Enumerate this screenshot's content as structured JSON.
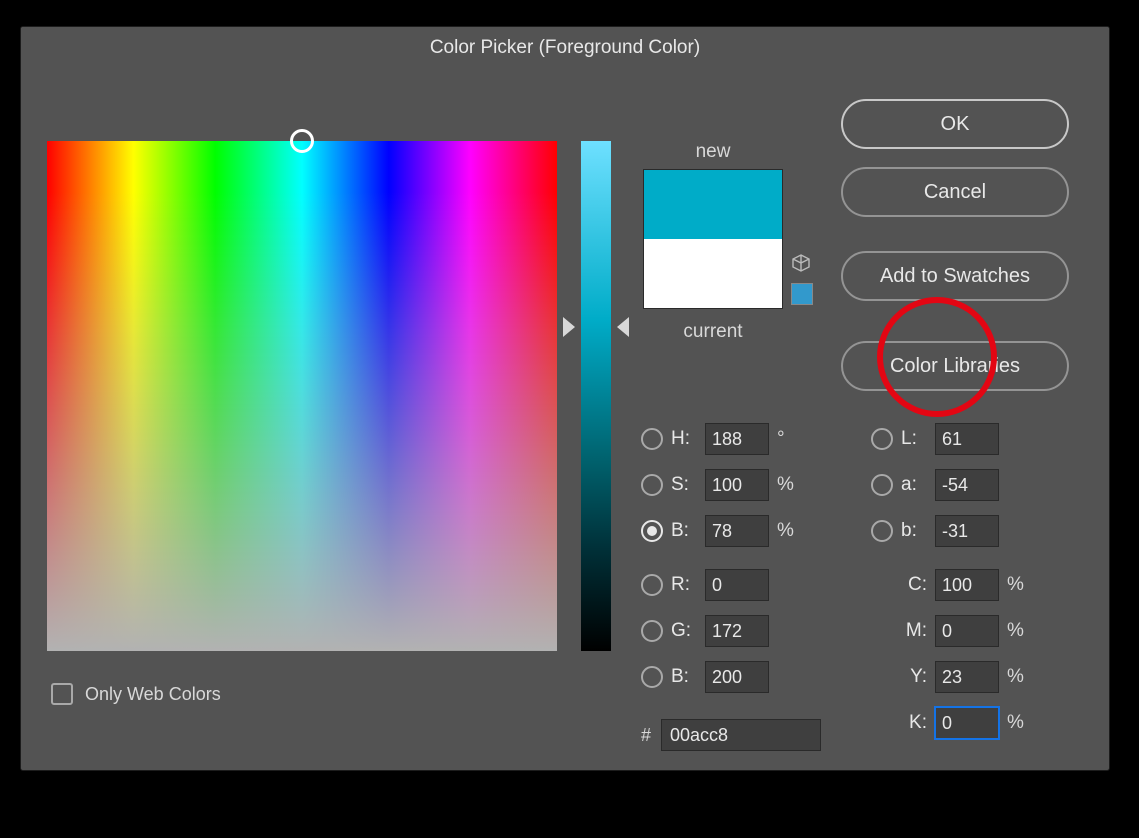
{
  "title": "Color Picker (Foreground Color)",
  "buttons": {
    "ok": "OK",
    "cancel": "Cancel",
    "add_swatches": "Add to Swatches",
    "color_libraries": "Color Libraries"
  },
  "labels": {
    "new": "new",
    "current": "current",
    "only_web": "Only Web Colors",
    "hex_prefix": "#"
  },
  "colors": {
    "new_hex": "#00acc8",
    "current_hex": "#ffffff",
    "websafe_hex": "#3399cc"
  },
  "hsb": {
    "h_label": "H:",
    "h_value": "188",
    "h_unit": "°",
    "s_label": "S:",
    "s_value": "100",
    "s_unit": "%",
    "b_label": "B:",
    "b_value": "78",
    "b_unit": "%",
    "selected": "B"
  },
  "rgb": {
    "r_label": "R:",
    "r_value": "0",
    "g_label": "G:",
    "g_value": "172",
    "b_label": "B:",
    "b_value": "200"
  },
  "lab": {
    "l_label": "L:",
    "l_value": "61",
    "a_label": "a:",
    "a_value": "-54",
    "b_label": "b:",
    "b_value": "-31"
  },
  "cmyk": {
    "c_label": "C:",
    "c_value": "100",
    "c_unit": "%",
    "m_label": "M:",
    "m_value": "0",
    "m_unit": "%",
    "y_label": "Y:",
    "y_value": "23",
    "y_unit": "%",
    "k_label": "K:",
    "k_value": "0",
    "k_unit": "%"
  },
  "hex_value": "00acc8",
  "chart_data": {
    "type": "table",
    "rows": [
      {
        "model": "HSB",
        "fields": {
          "H": 188,
          "S": 100,
          "B": 78
        }
      },
      {
        "model": "RGB",
        "fields": {
          "R": 0,
          "G": 172,
          "B": 200
        }
      },
      {
        "model": "Lab",
        "fields": {
          "L": 61,
          "a": -54,
          "b": -31
        }
      },
      {
        "model": "CMYK",
        "fields": {
          "C": 100,
          "M": 0,
          "Y": 23,
          "K": 0
        }
      },
      {
        "model": "Hex",
        "value": "00acc8"
      }
    ]
  }
}
